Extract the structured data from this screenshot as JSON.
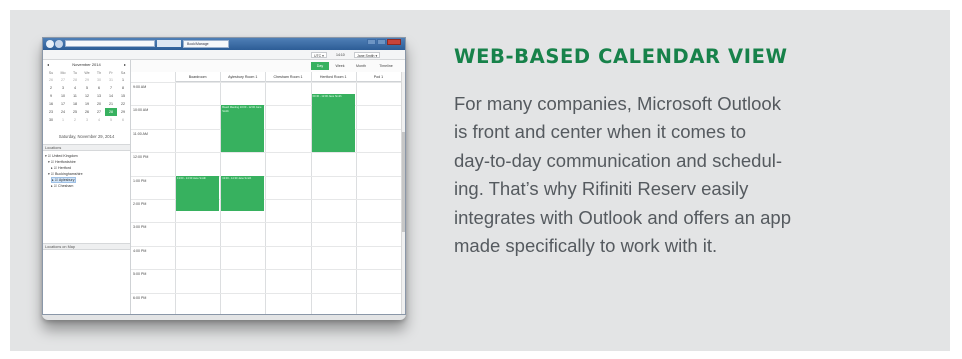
{
  "heading": "WEB-BASED CALENDAR VIEW",
  "body_lines": [
    "For many companies, Microsoft Outlook",
    "is front and center when it comes to",
    "day-to-day communication and schedul-",
    "ing. That’s why Rifiniti Reserv easily",
    "integrates with Outlook and offers an app",
    "made specifically to work with it."
  ],
  "colors": {
    "accent_green": "#17824a",
    "event_green": "#37b15f",
    "panel_bg": "#e3e4e5",
    "body_text": "#555a5f"
  },
  "screenshot": {
    "browser": {
      "tab_title": "Book/Manage"
    },
    "userbar": {
      "timezone": "UTC ▾",
      "time": "14:10",
      "user": "Jane Smith ▾"
    },
    "mini_calendar": {
      "prev": "◂",
      "next": "▸",
      "month_label": "November 2014",
      "weekdays": [
        "Su",
        "Mo",
        "Tu",
        "We",
        "Th",
        "Fr",
        "Sa"
      ],
      "weeks": [
        [
          "26",
          "27",
          "28",
          "29",
          "30",
          "31",
          "1"
        ],
        [
          "2",
          "3",
          "4",
          "5",
          "6",
          "7",
          "8"
        ],
        [
          "9",
          "10",
          "11",
          "12",
          "13",
          "14",
          "15"
        ],
        [
          "16",
          "17",
          "18",
          "19",
          "20",
          "21",
          "22"
        ],
        [
          "23",
          "24",
          "25",
          "26",
          "27",
          "28",
          "29"
        ],
        [
          "30",
          "1",
          "2",
          "3",
          "4",
          "5",
          "6"
        ]
      ],
      "selected_day": "28",
      "selected_date": "Saturday, November 29, 2014"
    },
    "locations": {
      "header": "Locations",
      "tree": [
        {
          "label": "▾ ☑ United Kingdom",
          "level": 1
        },
        {
          "label": "▾ ☑ Hertfordshire",
          "level": 2
        },
        {
          "label": "▸ ☑ Hertford",
          "level": 3
        },
        {
          "label": "▾ ☑ Buckinghamshire",
          "level": 2
        },
        {
          "label": "▸ ☑ Aylesbury",
          "level": 3,
          "selected": true
        },
        {
          "label": "▸ ☑ Chesham",
          "level": 3
        }
      ],
      "map_header": "Locations on Map"
    },
    "views": {
      "day": "Day",
      "week": "Week",
      "month": "Month",
      "timeline": "Timeline",
      "active": "day"
    },
    "rooms": [
      "Boardroom",
      "Aylesbury Room 1",
      "Chesham Room 1",
      "Hertford Room 1",
      "Pod 1"
    ],
    "times": [
      "9:00 AM",
      "10:00 AM",
      "11:00 AM",
      "12:00 PM",
      "1:00 PM",
      "2:00 PM",
      "3:00 PM",
      "4:00 PM",
      "5:00 PM",
      "6:00 PM"
    ],
    "events": [
      {
        "room_index": 1,
        "start_hour": 10.0,
        "end_hour": 12.0,
        "text": "Board Meeting 10:00 - 12:00 Jane Smith"
      },
      {
        "room_index": 3,
        "start_hour": 9.5,
        "end_hour": 12.0,
        "text": "09:30 - 12:00 Jane Smith"
      },
      {
        "room_index": 0,
        "start_hour": 13.0,
        "end_hour": 14.5,
        "text": "13:00 - 14:30 Jane Smith"
      },
      {
        "room_index": 1,
        "start_hour": 13.0,
        "end_hour": 14.5,
        "text": "13:00 - 14:30 Jane Smith"
      }
    ]
  }
}
